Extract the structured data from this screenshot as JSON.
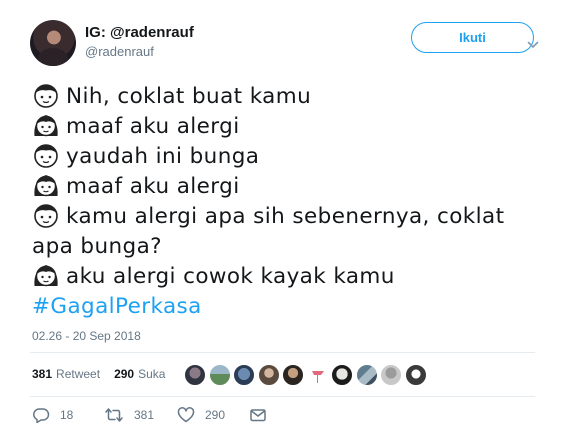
{
  "user": {
    "display_name": "IG: @radenrauf",
    "handle": "@radenrauf",
    "follow_label": "Ikuti"
  },
  "tweet": {
    "lines": [
      {
        "speaker": "boy-emoji",
        "text": "Nih, coklat buat kamu"
      },
      {
        "speaker": "girl-emoji",
        "text": "maaf aku alergi"
      },
      {
        "speaker": "boy-emoji",
        "text": "yaudah ini bunga"
      },
      {
        "speaker": "girl-emoji",
        "text": "maaf aku alergi"
      },
      {
        "speaker": "boy-emoji",
        "text": "kamu alergi apa sih sebenernya, coklat apa bunga?"
      },
      {
        "speaker": "girl-emoji",
        "text": "aku alergi cowok kayak kamu"
      }
    ],
    "hashtag": "#GagalPerkasa",
    "timestamp": "02.26 - 20 Sep 2018"
  },
  "stats": {
    "retweet_count": "381",
    "retweet_label": "Retweet",
    "like_count": "290",
    "like_label": "Suka"
  },
  "actions": {
    "reply_count": "18",
    "retweet_count": "381",
    "like_count": "290"
  },
  "colors": {
    "accent": "#1da1f2",
    "secondary_text": "#657786",
    "divider": "#e6ecf0"
  }
}
